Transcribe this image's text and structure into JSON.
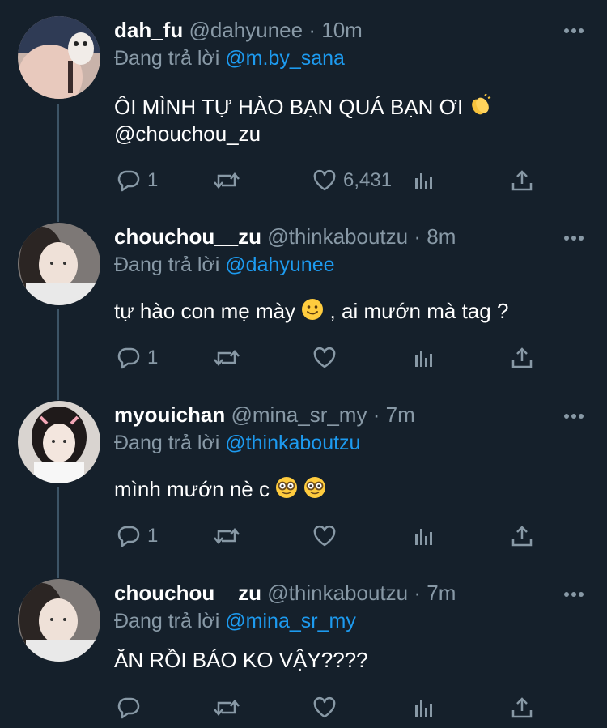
{
  "tweets": [
    {
      "name": "dah_fu",
      "handle": "@dahyunee",
      "dot": "·",
      "time": "10m",
      "reply_prefix": "Đang trả lời",
      "reply_to": "@m.by_sana",
      "text_line1": "ÔI MÌNH TỰ HÀO BẠN QUÁ BẠN ƠI",
      "text_line2": "@chouchou_zu",
      "reply_count": "1",
      "like_count": "6,431"
    },
    {
      "name": "chouchou__zu",
      "handle": "@thinkaboutzu",
      "dot": "·",
      "time": "8m",
      "reply_prefix": "Đang trả lời",
      "reply_to": "@dahyunee",
      "text_line1_a": "tự hào con mẹ mày",
      "text_line1_b": ", ai mướn mà tag ?",
      "reply_count": "1"
    },
    {
      "name": "myouichan",
      "handle": "@mina_sr_my",
      "dot": "·",
      "time": "7m",
      "reply_prefix": "Đang trả lời",
      "reply_to": "@thinkaboutzu",
      "text_line1": "mình mướn nè c",
      "reply_count": "1"
    },
    {
      "name": "chouchou__zu",
      "handle": "@thinkaboutzu",
      "dot": "·",
      "time": "7m",
      "reply_prefix": "Đang trả lời",
      "reply_to": "@mina_sr_my",
      "text_line1": "ĂN RỒI BÁO KO VẬY????"
    }
  ],
  "colors": {
    "background": "#15202b",
    "secondary_text": "#8899a6",
    "link": "#1d9bf0",
    "thread_line": "#3d5466"
  },
  "icons": [
    "reply-icon",
    "retweet-icon",
    "like-icon",
    "analytics-icon",
    "share-icon",
    "more-icon",
    "clapping-hands-emoji",
    "slight-smile-emoji",
    "nerd-face-emoji"
  ]
}
